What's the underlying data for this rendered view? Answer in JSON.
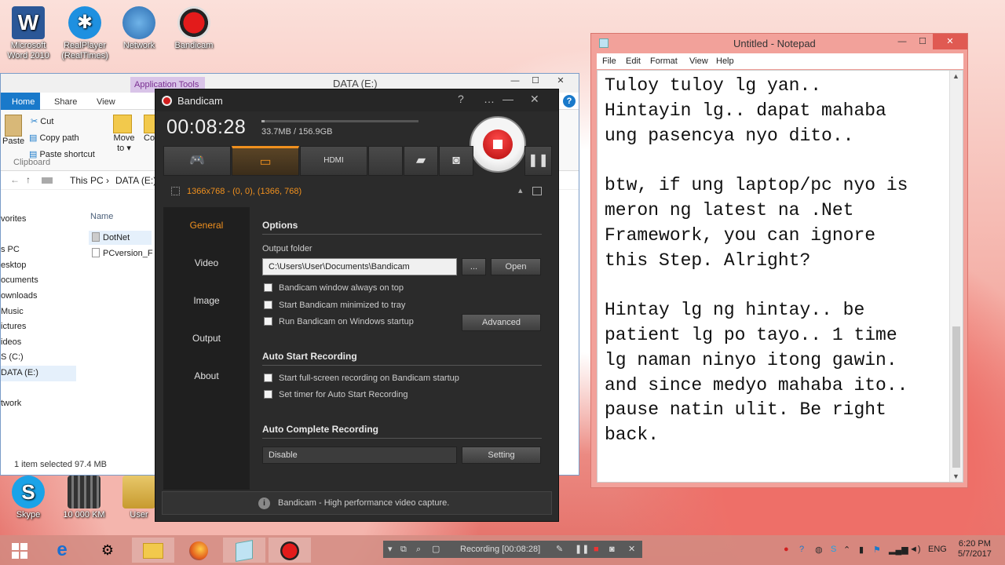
{
  "desktop": {
    "icons": [
      {
        "label": "Microsoft Word 2010",
        "name": "word-icon"
      },
      {
        "label": "RealPlayer (RealTimes)",
        "name": "realplayer-icon"
      },
      {
        "label": "Network",
        "name": "network-icon"
      },
      {
        "label": "Bandicam",
        "name": "bandicam-icon"
      },
      {
        "label": "Skype",
        "name": "skype-icon"
      },
      {
        "label": "10 000 KM",
        "name": "film-icon"
      },
      {
        "label": "User",
        "name": "user-icon"
      }
    ]
  },
  "explorer": {
    "app_tools": "Application Tools",
    "title": "DATA (E:)",
    "tabs": [
      "Home",
      "Share",
      "View"
    ],
    "ribbon": {
      "cut": "Cut",
      "copy_path": "Copy path",
      "paste": "Paste",
      "paste_shortcut": "Paste shortcut",
      "move_to": "Move to ▾",
      "copy_to": "Co",
      "group_label": "Clipboard"
    },
    "address": {
      "this_pc": "This PC",
      "sep": "›",
      "drive": "DATA (E:)"
    },
    "nav_items": [
      "vorites",
      "",
      "s PC",
      "esktop",
      "ocuments",
      "ownloads",
      "Music",
      "ictures",
      "ideos",
      "S (C:)",
      "DATA (E:)",
      "",
      "twork"
    ],
    "column_header": "Name",
    "files": [
      "DotNet",
      "PCversion_F"
    ],
    "status": "1 item selected  97.4 MB"
  },
  "bandicam": {
    "title": "Bandicam",
    "help": "?",
    "timer": "00:08:28",
    "size": "33.7MB / 156.9GB",
    "disk_used_fraction": 0.02,
    "region": "1366x768 - (0, 0), (1366, 768)",
    "sidebar": [
      "General",
      "Video",
      "Image",
      "Output",
      "About"
    ],
    "options": {
      "title": "Options",
      "output_folder_label": "Output folder",
      "output_folder": "C:\\Users\\User\\Documents\\Bandicam",
      "browse": "...",
      "open": "Open",
      "always_on_top": "Bandicam window always on top",
      "minimized": "Start Bandicam minimized to tray",
      "startup": "Run Bandicam on Windows startup",
      "advanced": "Advanced"
    },
    "auto_start": {
      "title": "Auto Start Recording",
      "fullscreen": "Start full-screen recording on Bandicam startup",
      "timer": "Set timer for Auto Start Recording"
    },
    "auto_complete": {
      "title": "Auto Complete Recording",
      "value": "Disable",
      "setting": "Setting"
    },
    "footer": "Bandicam - High performance video capture."
  },
  "notepad": {
    "title": "Untitled - Notepad",
    "menu": [
      "File",
      "Edit",
      "Format",
      "View",
      "Help"
    ],
    "text": "Tuloy tuloy lg yan..\nHintayin lg.. dapat mahaba\nung pasencya nyo dito..\n\nbtw, if ung laptop/pc nyo is\nmeron ng latest na .Net\nFramework, you can ignore\nthis Step. Alright?\n\nHintay lg ng hintay.. be\npatient lg po tayo.. 1 time\nlg naman ninyo itong gawin.\nand since medyo mahaba ito..\npause natin ulit. Be right\nback."
  },
  "taskbar": {
    "recording": "Recording [00:08:28]",
    "lang": "ENG",
    "time": "6:20 PM",
    "date": "5/7/2017"
  },
  "colors": {
    "bandicam_accent": "#f0901e",
    "record_red": "#d21f1f"
  }
}
